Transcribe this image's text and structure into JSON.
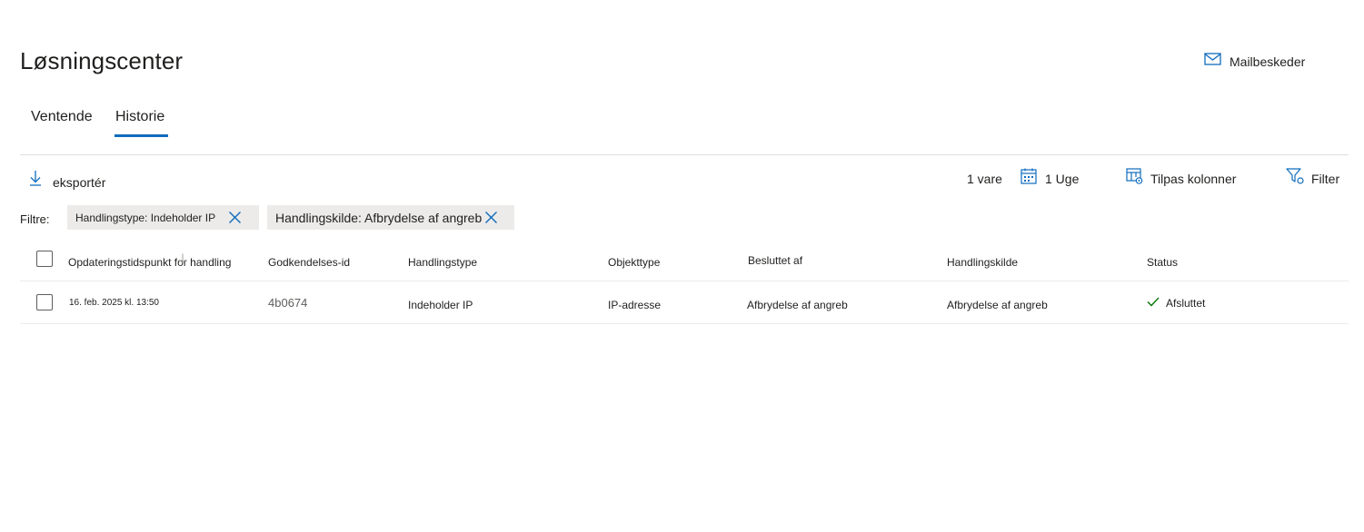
{
  "page": {
    "title": "Løsningscenter",
    "mail_button_label": "Mailbeskeder"
  },
  "tabs": [
    {
      "label": "Ventende",
      "selected": false
    },
    {
      "label": "Historie",
      "selected": true
    }
  ],
  "toolbar": {
    "export_label": "eksportér",
    "item_count": "1 vare",
    "date_range": "1 Uge",
    "customize_columns_label": "Tilpas kolonner",
    "filter_label": "Filter"
  },
  "filters": {
    "label": "Filtre:",
    "chips": [
      {
        "label": "Handlingstype: Indeholder IP"
      },
      {
        "label": "Handlingskilde: Afbrydelse af angreb"
      }
    ]
  },
  "table": {
    "columns": [
      "Opdateringstidspunkt for handling",
      "Godkendelses-id",
      "Handlingstype",
      "Objekttype",
      "Besluttet af",
      "Handlingskilde",
      "Status"
    ],
    "rows": [
      {
        "updated": "16. feb. 2025 kl. 13:50",
        "approval_id": "4b0674",
        "action_type": "Indeholder IP",
        "object_type": "IP-adresse",
        "decided_by": "Afbrydelse af angreb",
        "action_source": "Afbrydelse af angreb",
        "status": "Afsluttet"
      }
    ]
  },
  "colors": {
    "accent": "#0f6cbd",
    "success": "#107c10",
    "chip_background": "#edebe9",
    "text": "#201f1e"
  },
  "icons": {
    "mail": "mail-icon",
    "export": "download-arrow-icon",
    "calendar": "calendar-icon",
    "columns": "customize-columns-icon",
    "filter": "filter-funnel-icon",
    "remove": "close-icon",
    "sort": "sort-down-arrow-icon",
    "status": "checkmark-icon"
  }
}
